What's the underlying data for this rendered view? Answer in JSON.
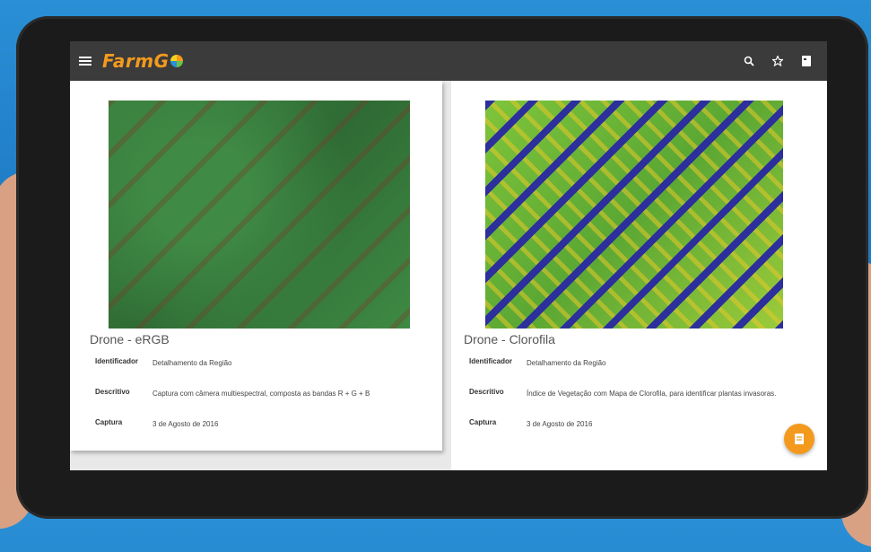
{
  "app": {
    "logo_text": "FarmG",
    "accent": "#f39a1e",
    "appbar_color": "#3b3b3b"
  },
  "appbar": {
    "menu_icon": "menu-icon",
    "actions": [
      "search-icon",
      "star-icon",
      "document-icon"
    ]
  },
  "cards": [
    {
      "title": "Drone - eRGB",
      "image": "drone-ergb-field-photo",
      "fields": [
        {
          "key": "Identificador",
          "value": "Detalhamento da Região"
        },
        {
          "key": "Descritivo",
          "value": "Captura com câmera multiespectral, composta as bandas R + G + B"
        },
        {
          "key": "Captura",
          "value": "3 de Agosto de 2016"
        }
      ]
    },
    {
      "title": "Drone - Clorofila",
      "image": "drone-chlorophyll-map",
      "fields": [
        {
          "key": "Identificador",
          "value": "Detalhamento da Região"
        },
        {
          "key": "Descritivo",
          "value": "Índice de Vegetação com Mapa de Clorofila, para identificar plantas invasoras."
        },
        {
          "key": "Captura",
          "value": "3 de Agosto de 2016"
        }
      ]
    }
  ],
  "fab": {
    "icon": "document-icon"
  }
}
